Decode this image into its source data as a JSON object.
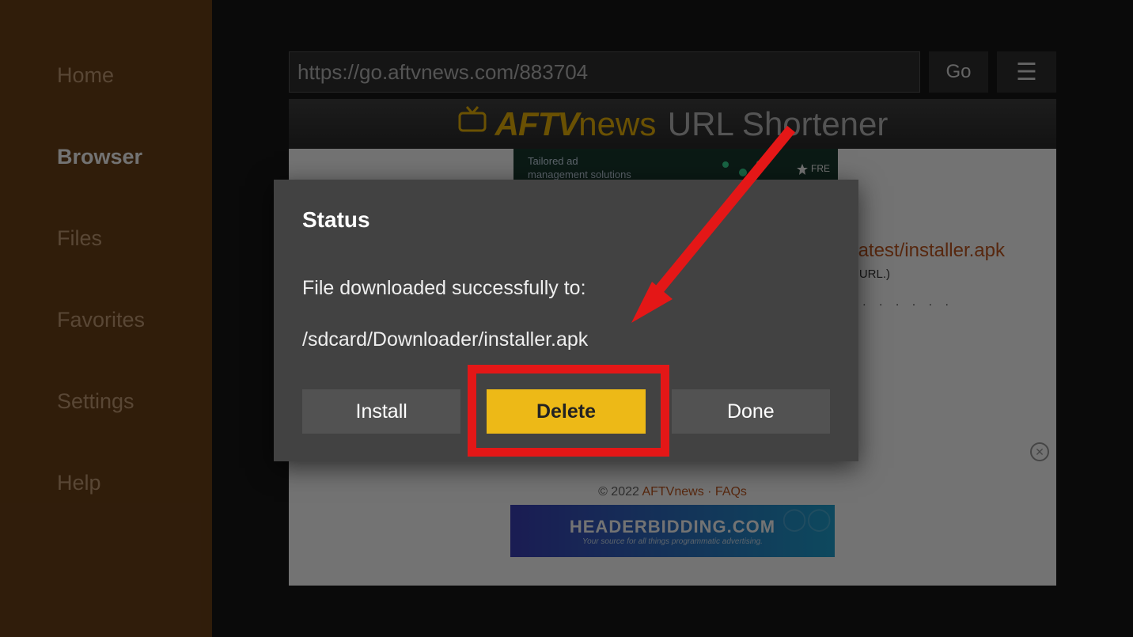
{
  "sidebar": {
    "items": [
      {
        "label": "Home"
      },
      {
        "label": "Browser"
      },
      {
        "label": "Files"
      },
      {
        "label": "Favorites"
      },
      {
        "label": "Settings"
      },
      {
        "label": "Help"
      }
    ],
    "active_index": 1
  },
  "toolbar": {
    "url_value": "https://go.aftvnews.com/883704",
    "go_label": "Go",
    "menu_glyph": "☰"
  },
  "page_header": {
    "brand_left": "AFTV",
    "brand_mid": "news",
    "brand_right": "URL Shortener"
  },
  "ad": {
    "text": "Tailored ad\nmanagement solutions",
    "free_text": "FRE"
  },
  "page_content": {
    "installer_link": "atest/installer.apk",
    "url_note": "URL.)",
    "dots": ". . . . . . . . . . . . . . . . . . . . .",
    "footer_year": "© 2022 ",
    "footer_links": "AFTVnews · FAQs"
  },
  "footer_ad": {
    "big": "HEADERBIDDING.COM",
    "small": "Your source for all things programmatic advertising."
  },
  "dialog": {
    "title": "Status",
    "line1": "File downloaded successfully to:",
    "line2": "/sdcard/Downloader/installer.apk",
    "install_label": "Install",
    "delete_label": "Delete",
    "done_label": "Done"
  }
}
